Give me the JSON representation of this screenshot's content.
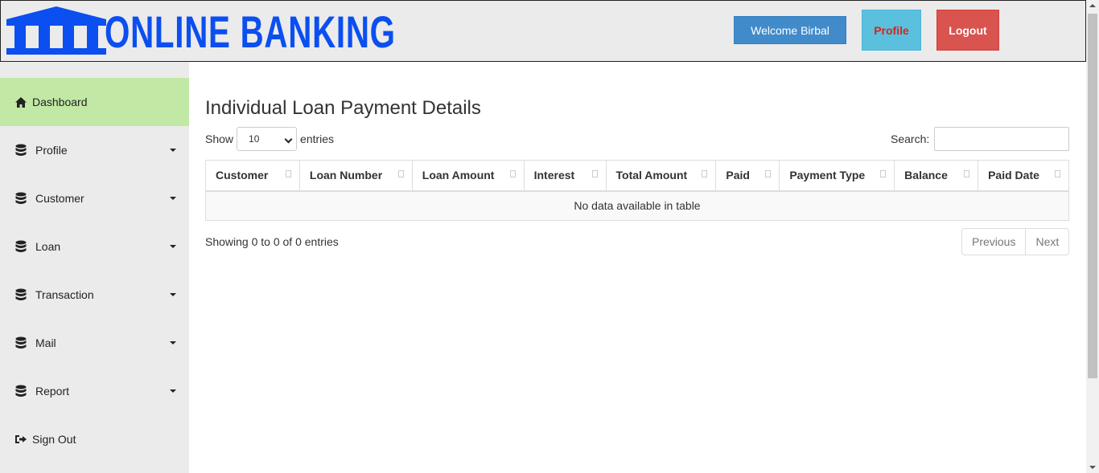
{
  "header": {
    "logo_text": "ONLINE BANKING",
    "welcome_text": "Welcome Birbal",
    "profile_label": "Profile",
    "logout_label": "Logout"
  },
  "sidebar": {
    "items": [
      {
        "label": "Dashboard",
        "icon": "home-icon",
        "active": true
      },
      {
        "label": "Profile",
        "icon": "database-icon",
        "has_caret": true
      },
      {
        "label": "Customer",
        "icon": "database-icon",
        "has_caret": true
      },
      {
        "label": "Loan",
        "icon": "database-icon",
        "has_caret": true
      },
      {
        "label": "Transaction",
        "icon": "database-icon",
        "has_caret": true
      },
      {
        "label": "Mail",
        "icon": "database-icon",
        "has_caret": true
      },
      {
        "label": "Report",
        "icon": "database-icon",
        "has_caret": true
      },
      {
        "label": "Sign Out",
        "icon": "sign-out-icon"
      }
    ]
  },
  "main": {
    "title": "Individual Loan Payment Details",
    "show_label": "Show",
    "entries_label": "entries",
    "page_size": "10",
    "search_label": "Search:",
    "search_value": "",
    "columns": [
      "Customer",
      "Loan Number",
      "Loan Amount",
      "Interest",
      "Total Amount",
      "Paid",
      "Payment Type",
      "Balance",
      "Paid Date"
    ],
    "empty_message": "No data available in table",
    "info": "Showing 0 to 0 of 0 entries",
    "pager": {
      "previous": "Previous",
      "next": "Next"
    }
  },
  "colors": {
    "logo": "#0b4ff0",
    "active_nav": "#c1e8a4",
    "welcome_bg": "#428bca",
    "profile_bg": "#5bc0de",
    "profile_text": "#d9231a",
    "logout_bg": "#d9534f"
  }
}
